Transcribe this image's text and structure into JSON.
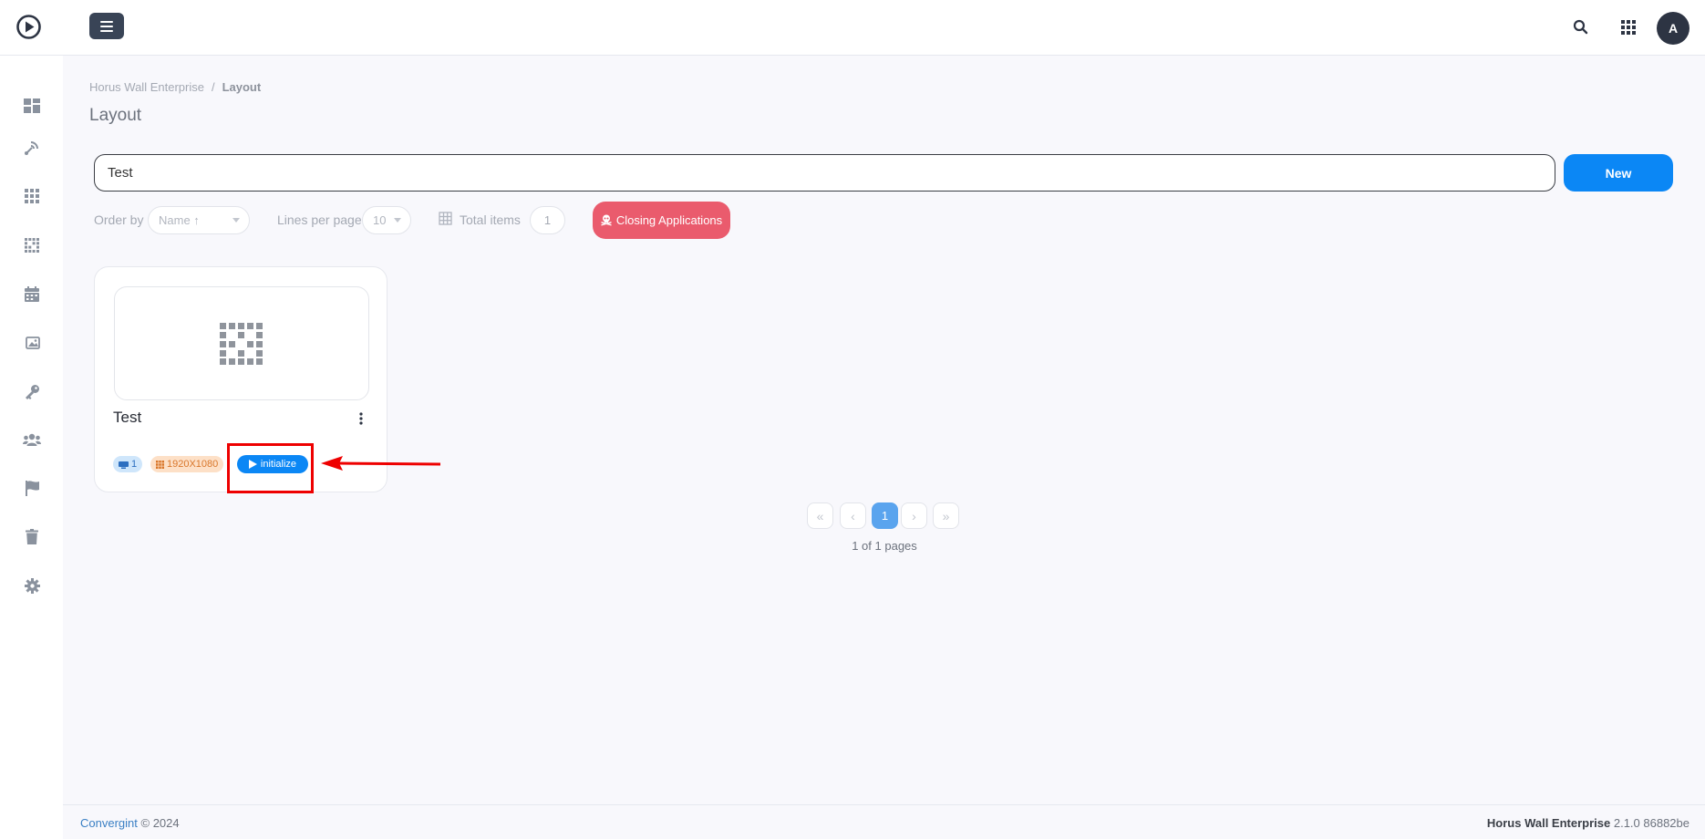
{
  "header": {
    "avatar_initial": "A",
    "icons": [
      "play-circle-logo",
      "hamburger-menu",
      "search-icon",
      "apps-grid-icon"
    ]
  },
  "sidebar": {
    "icons": [
      "dashboard-icon",
      "broadcast-icon",
      "grid-icon",
      "layout-icon",
      "calendar-icon",
      "image-icon",
      "key-icon",
      "users-icon",
      "flag-icon",
      "trash-icon",
      "gear-icon"
    ]
  },
  "breadcrumb": {
    "parent": "Horus Wall Enterprise",
    "separator": "/",
    "current": "Layout"
  },
  "page_title": "Layout",
  "search": {
    "value": "Test"
  },
  "new_button": "New",
  "filters": {
    "order_by_label": "Order by",
    "order_by_value": "Name ↑",
    "lines_label": "Lines per page",
    "lines_value": "10",
    "total_label": "Total items",
    "total_value": "1",
    "closing_button": "Closing Applications"
  },
  "cards": [
    {
      "title": "Test",
      "screens": "1",
      "resolution": "1920X1080",
      "action": "initialize"
    }
  ],
  "pagination": {
    "current_page": "1",
    "info": "1 of 1 pages"
  },
  "footer": {
    "company": "Convergint",
    "copyright": "© 2024",
    "product": "Horus Wall Enterprise",
    "version": "2.1.0 86882be"
  },
  "colors": {
    "primary": "#0b87f5",
    "danger": "#ea5b6d",
    "dark": "#394456",
    "annotation": "#ee0000"
  }
}
